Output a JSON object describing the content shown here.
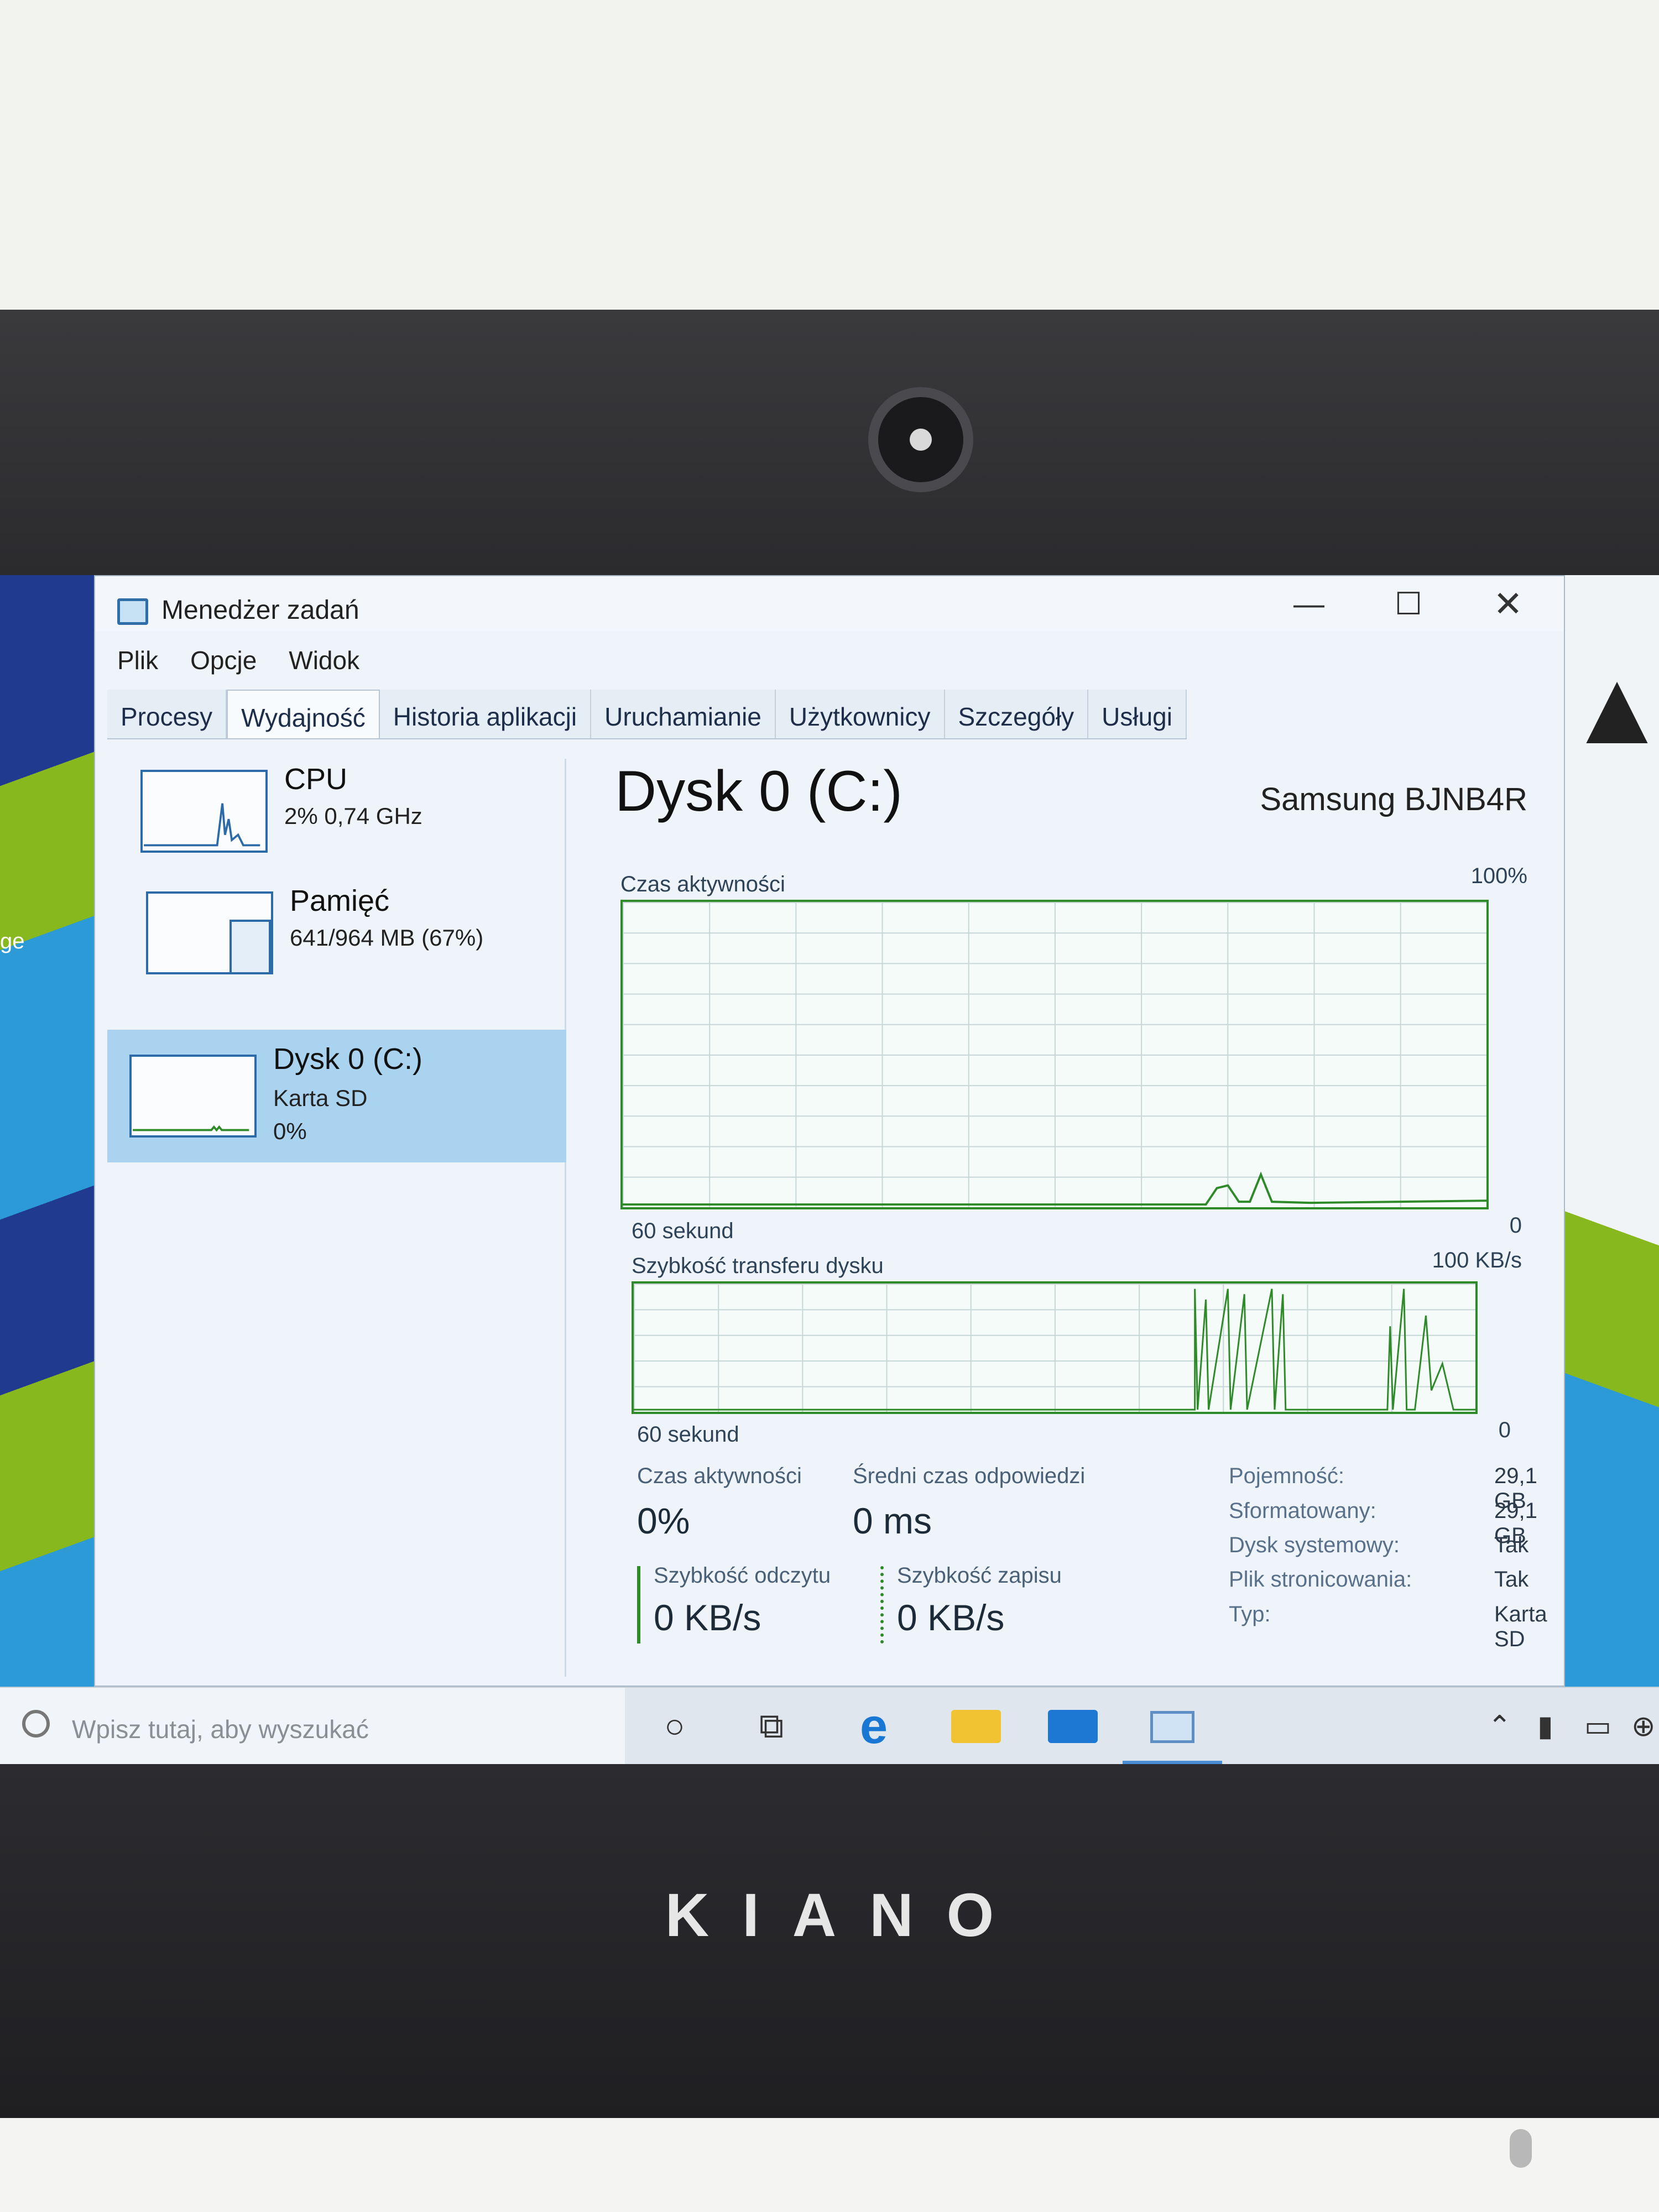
{
  "window": {
    "title": "Menedżer zadań",
    "minimize_glyph": "—",
    "maximize_glyph": "☐",
    "close_glyph": "✕"
  },
  "menu": [
    "Plik",
    "Opcje",
    "Widok"
  ],
  "tabs": [
    {
      "label": "Procesy",
      "active": false
    },
    {
      "label": "Wydajność",
      "active": true
    },
    {
      "label": "Historia aplikacji",
      "active": false
    },
    {
      "label": "Uruchamianie",
      "active": false
    },
    {
      "label": "Użytkownicy",
      "active": false
    },
    {
      "label": "Szczegóły",
      "active": false
    },
    {
      "label": "Usługi",
      "active": false
    }
  ],
  "sidebar": {
    "cpu": {
      "name": "CPU",
      "detail": "2% 0,74 GHz"
    },
    "memory": {
      "name": "Pamięć",
      "detail": "641/964 MB (67%)",
      "used_fraction": 0.67
    },
    "disk": {
      "name": "Dysk 0 (C:)",
      "type": "Karta SD",
      "usage": "0%"
    }
  },
  "main": {
    "title": "Dysk 0 (C:)",
    "model": "Samsung BJNB4R",
    "activity_graph": {
      "label": "Czas aktywności",
      "max": "100%",
      "time_label": "60 sekund",
      "min": "0"
    },
    "transfer_graph": {
      "label": "Szybkość transferu dysku",
      "max": "100 KB/s",
      "time_label": "60 sekund",
      "min": "0"
    },
    "stats": {
      "active_time_label": "Czas aktywności",
      "active_time_value": "0%",
      "response_label": "Średni czas odpowiedzi",
      "response_value": "0 ms",
      "read_label": "Szybkość odczytu",
      "read_value": "0 KB/s",
      "write_label": "Szybkość zapisu",
      "write_value": "0 KB/s"
    },
    "properties": [
      {
        "label": "Pojemność:",
        "value": "29,1 GB"
      },
      {
        "label": "Sformatowany:",
        "value": "29,1 GB"
      },
      {
        "label": "Dysk systemowy:",
        "value": "Tak"
      },
      {
        "label": "Plik stronicowania:",
        "value": "Tak"
      },
      {
        "label": "Typ:",
        "value": "Karta SD"
      }
    ]
  },
  "taskbar": {
    "search_placeholder": "Wpisz tutaj, aby wyszukać",
    "icons": [
      "cortana-icon",
      "task-view-icon",
      "edge-icon",
      "file-explorer-icon",
      "mail-icon",
      "task-manager-icon"
    ]
  },
  "desktop": {
    "edge_label": "ge"
  },
  "device": {
    "brand": "KIANO"
  },
  "colors": {
    "accent": "#2f8a2a",
    "selection": "#a9d3ef",
    "tab_text": "#1e2e4a"
  }
}
